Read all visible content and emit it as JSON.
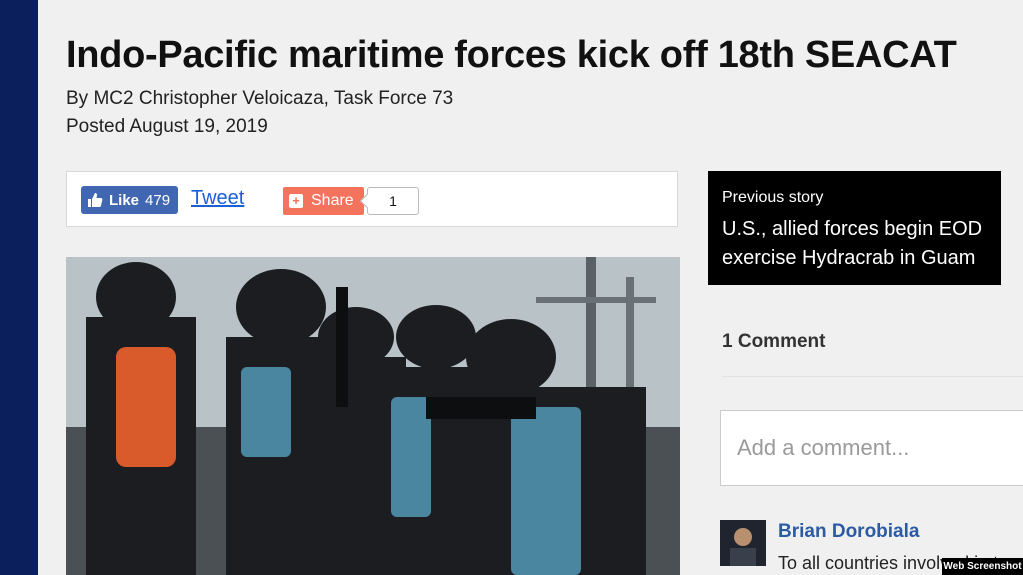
{
  "article": {
    "headline": "Indo-Pacific maritime forces kick off 18th SEACAT",
    "byline": "By MC2 Christopher Veloicaza, Task Force 73",
    "posted": "Posted August 19, 2019"
  },
  "share_bar": {
    "like_label": "Like",
    "like_count": "479",
    "tweet_label": "Tweet",
    "share_label": "Share",
    "share_count": "1"
  },
  "previous_story": {
    "label": "Previous story",
    "title": "U.S., allied forces begin EOD exercise Hydracrab in Guam"
  },
  "comments": {
    "heading": "1 Comment",
    "input_placeholder": "Add a comment...",
    "items": [
      {
        "author": "Brian Dorobiala",
        "text": "To all countries involved in t"
      }
    ]
  },
  "watermark": "Web Screenshot",
  "colors": {
    "left_bar": "#0b1f5c",
    "facebook": "#4267b2",
    "share": "#f4735c",
    "link": "#1a5fd8",
    "author": "#2b5ba3"
  }
}
